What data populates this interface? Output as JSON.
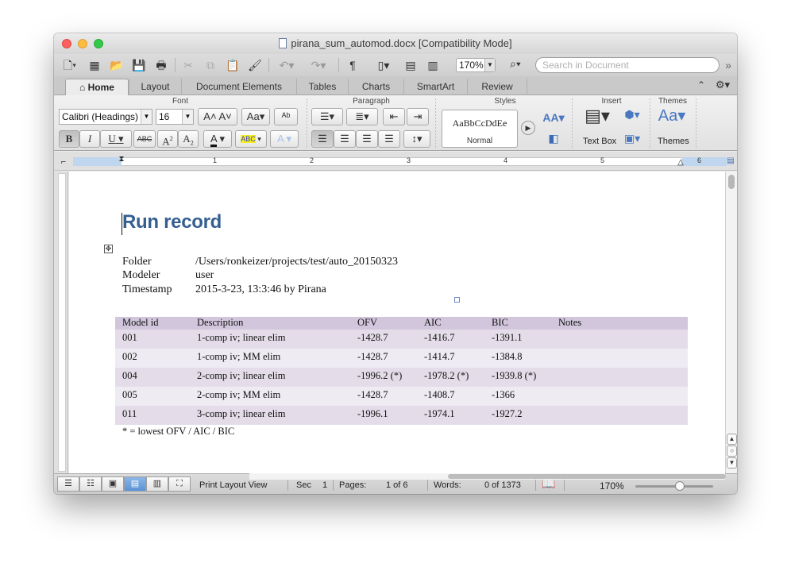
{
  "window": {
    "title": "pirana_sum_automod.docx [Compatibility Mode]"
  },
  "toolbar": {
    "paragraph_mark": "¶",
    "zoom_value": "170%",
    "search_placeholder": "Search in Document",
    "overflow": "»"
  },
  "ribbon_tabs": [
    "Home",
    "Layout",
    "Document Elements",
    "Tables",
    "Charts",
    "SmartArt",
    "Review"
  ],
  "ribbon": {
    "group_font": "Font",
    "group_paragraph": "Paragraph",
    "group_styles": "Styles",
    "group_insert": "Insert",
    "group_themes": "Themes",
    "font_name": "Calibri (Headings)",
    "font_size": "16",
    "style_sample": "AaBbCcDdEe",
    "style_name": "Normal",
    "textbox_label": "Text Box",
    "themes_label": "Themes",
    "font_buttons": {
      "grow": "A",
      "shrink": "A",
      "case": "Aa",
      "bold": "B",
      "italic": "I",
      "underline": "U",
      "strike": "ABC",
      "superscript": "A",
      "subscript": "A",
      "font_color": "A",
      "highlight": "ABC",
      "text_effects": "A"
    }
  },
  "ruler": {
    "numbers": [
      "1",
      "2",
      "3",
      "4",
      "5",
      "6"
    ]
  },
  "document": {
    "title": "Run record",
    "info": [
      {
        "label": "Folder",
        "value": "/Users/ronkeizer/projects/test/auto_20150323"
      },
      {
        "label": "Modeler",
        "value": "user"
      },
      {
        "label": "Timestamp",
        "value": "2015-3-23, 13:3:46 by Pirana"
      }
    ],
    "table": {
      "headers": [
        "Model id",
        "Description",
        "OFV",
        "AIC",
        "BIC",
        "Notes"
      ],
      "rows": [
        [
          "001",
          "1-comp iv; linear elim",
          "-1428.7",
          "-1416.7",
          "-1391.1",
          ""
        ],
        [
          "002",
          "1-comp iv; MM elim",
          "-1428.7",
          "-1414.7",
          "-1384.8",
          ""
        ],
        [
          "004",
          "2-comp iv; linear elim",
          "-1996.2 (*)",
          "-1978.2 (*)",
          "-1939.8 (*)",
          ""
        ],
        [
          "005",
          "2-comp iv; MM elim",
          "-1428.7",
          "-1408.7",
          "-1366",
          ""
        ],
        [
          "011",
          "3-comp iv; linear elim",
          "-1996.1",
          "-1974.1",
          "-1927.2",
          ""
        ]
      ]
    },
    "footnote": "* = lowest OFV / AIC / BIC"
  },
  "statusbar": {
    "view": "Print Layout View",
    "sec_label": "Sec",
    "sec_value": "1",
    "pages_label": "Pages:",
    "pages_value": "1 of 6",
    "words_label": "Words:",
    "words_value": "0 of 1373",
    "zoom": "170%"
  },
  "colors": {
    "heading": "#355f8f",
    "table_header": "#d1c6dc",
    "table_row_a": "#e4dde9",
    "table_row_b": "#efebf2",
    "view_active": "#5a92d6"
  }
}
